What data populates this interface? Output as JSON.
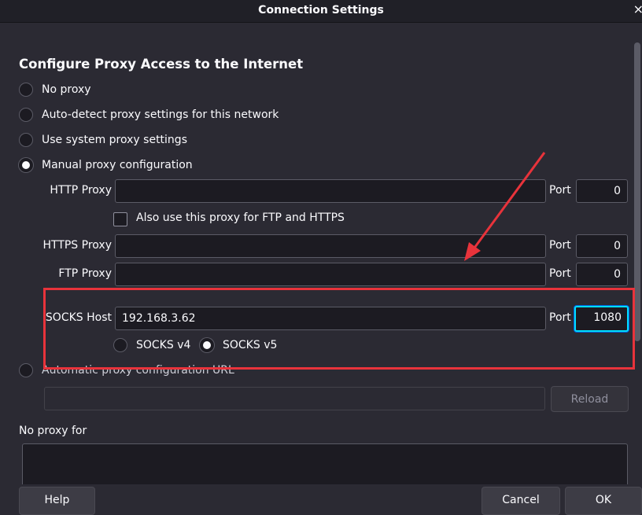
{
  "window": {
    "title": "Connection Settings",
    "close_glyph": "×"
  },
  "heading": "Configure Proxy Access to the Internet",
  "proxy_options": [
    {
      "label": "No proxy",
      "checked": false
    },
    {
      "label": "Auto-detect proxy settings for this network",
      "checked": false
    },
    {
      "label": "Use system proxy settings",
      "checked": false
    },
    {
      "label": "Manual proxy configuration",
      "checked": true
    }
  ],
  "manual": {
    "http_label": "HTTP Proxy",
    "http_value": "",
    "http_port_label": "Port",
    "http_port": "0",
    "also_use_label": "Also use this proxy for FTP and HTTPS",
    "https_label": "HTTPS Proxy",
    "https_value": "",
    "https_port_label": "Port",
    "https_port": "0",
    "ftp_label": "FTP Proxy",
    "ftp_value": "",
    "ftp_port_label": "Port",
    "ftp_port": "0",
    "socks_label": "SOCKS Host",
    "socks_value": "192.168.3.62",
    "socks_port_label": "Port",
    "socks_port": "1080",
    "socks_v4_label": "SOCKS v4",
    "socks_v5_label": "SOCKS v5",
    "socks_version_selected": "v5"
  },
  "auto_config": {
    "label": "Automatic proxy configuration URL",
    "value": "",
    "reload_label": "Reload"
  },
  "no_proxy": {
    "label": "No proxy for",
    "value": ""
  },
  "footer": {
    "help_label": "Help",
    "cancel_label": "Cancel",
    "ok_label": "OK"
  },
  "annotation": {
    "color": "#e8333b"
  },
  "colors": {
    "background": "#2b2a33",
    "field": "#1c1b22",
    "focus": "#00ddff"
  }
}
